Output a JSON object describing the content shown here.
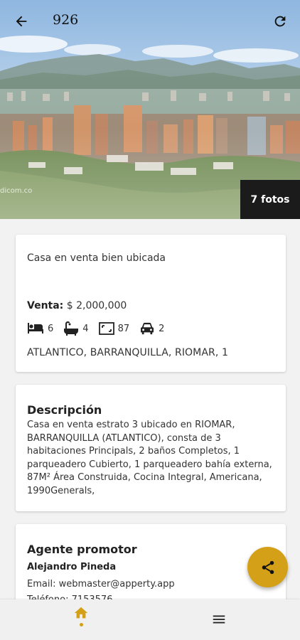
{
  "app_bar": {
    "title": "926"
  },
  "hero": {
    "photo_count_label": "7 fotos",
    "watermark": "dicom.co"
  },
  "listing": {
    "title": "Casa en venta bien ubicada",
    "price_label": "Venta:",
    "price_value": "$ 2,000,000",
    "features": [
      {
        "icon": "bed-icon",
        "value": "6"
      },
      {
        "icon": "bathtub-icon",
        "value": "4"
      },
      {
        "icon": "area-icon",
        "value": "87"
      },
      {
        "icon": "car-icon",
        "value": "2"
      }
    ],
    "location": "ATLANTICO, BARRANQUILLA, RIOMAR, 1"
  },
  "description": {
    "heading": "Descripción",
    "text": "Casa en venta estrato 3 ubicado en RIOMAR, BARRANQUILLA (ATLANTICO), consta de 3 habitaciones Principals, 2 baños Completos, 1 parqueadero Cubierto, 1 parqueadero bahía externa, 87M² Área Construida,  Cocina Integral, Americana, 1990Generals,"
  },
  "agent": {
    "heading": "Agente promotor",
    "name": "Alejandro Pineda",
    "email": "Email: webmaster@apperty.app",
    "phone": "Teléfono: 7153576"
  },
  "colors": {
    "accent": "#d4a017",
    "dark_badge": "#1b1b1b"
  },
  "bottom_nav": {
    "items": [
      {
        "icon": "home-icon",
        "active": true
      },
      {
        "icon": "menu-icon",
        "active": false
      }
    ]
  }
}
